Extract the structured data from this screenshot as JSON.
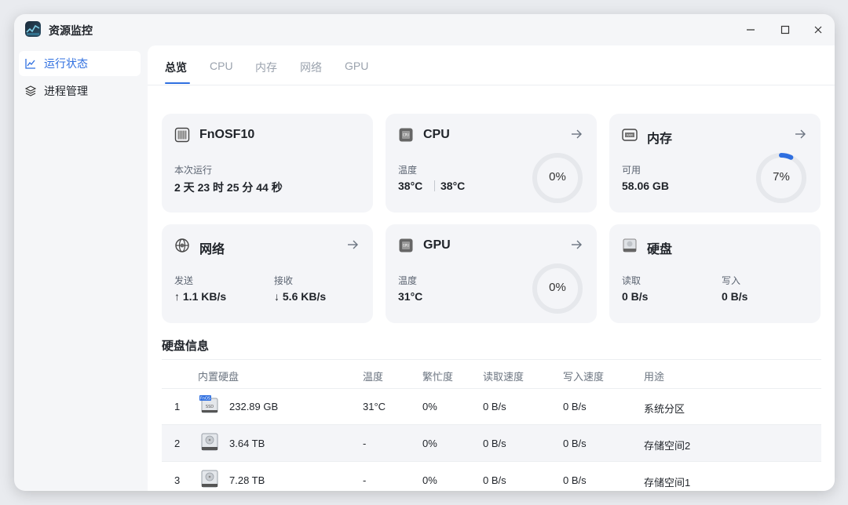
{
  "app": {
    "title": "资源监控"
  },
  "sidebar": {
    "items": [
      {
        "label": "运行状态",
        "icon": "chart-line-icon"
      },
      {
        "label": "进程管理",
        "icon": "layers-icon"
      }
    ]
  },
  "tabs": [
    {
      "label": "总览"
    },
    {
      "label": "CPU"
    },
    {
      "label": "内存"
    },
    {
      "label": "网络"
    },
    {
      "label": "GPU"
    }
  ],
  "cards": {
    "system": {
      "title": "FnOSF10",
      "uptime_label": "本次运行",
      "uptime_value": "2 天 23 时 25 分 44 秒"
    },
    "cpu": {
      "title": "CPU",
      "temp_label": "温度",
      "temp1": "38°C",
      "temp2": "38°C",
      "usage": "0%",
      "usage_fraction": 0
    },
    "memory": {
      "title": "内存",
      "avail_label": "可用",
      "avail_value": "58.06 GB",
      "usage": "7%",
      "usage_fraction": 0.07
    },
    "network": {
      "title": "网络",
      "send_label": "发送",
      "send_value": "↑ 1.1 KB/s",
      "recv_label": "接收",
      "recv_value": "↓ 5.6 KB/s"
    },
    "gpu": {
      "title": "GPU",
      "temp_label": "温度",
      "temp_value": "31°C",
      "usage": "0%",
      "usage_fraction": 0
    },
    "disk": {
      "title": "硬盘",
      "read_label": "读取",
      "read_value": "0 B/s",
      "write_label": "写入",
      "write_value": "0 B/s"
    }
  },
  "disk_info": {
    "title": "硬盘信息",
    "columns": [
      "内置硬盘",
      "温度",
      "繁忙度",
      "读取速度",
      "写入速度",
      "用途"
    ],
    "rows": [
      {
        "index": "1",
        "size": "232.89 GB",
        "temp": "31°C",
        "busy": "0%",
        "read": "0 B/s",
        "write": "0 B/s",
        "usage": "系统分区",
        "icon": "ssd-icon",
        "badge": "FnOS",
        "badge_sub": "SSD"
      },
      {
        "index": "2",
        "size": "3.64 TB",
        "temp": "-",
        "busy": "0%",
        "read": "0 B/s",
        "write": "0 B/s",
        "usage": "存储空间2",
        "icon": "hdd-icon"
      },
      {
        "index": "3",
        "size": "7.28 TB",
        "temp": "-",
        "busy": "0%",
        "read": "0 B/s",
        "write": "0 B/s",
        "usage": "存储空间1",
        "icon": "hdd-icon"
      }
    ]
  },
  "colors": {
    "accent": "#2f6fe0",
    "gauge_track": "#e6e8ec",
    "card_bg": "#f4f5f8"
  }
}
